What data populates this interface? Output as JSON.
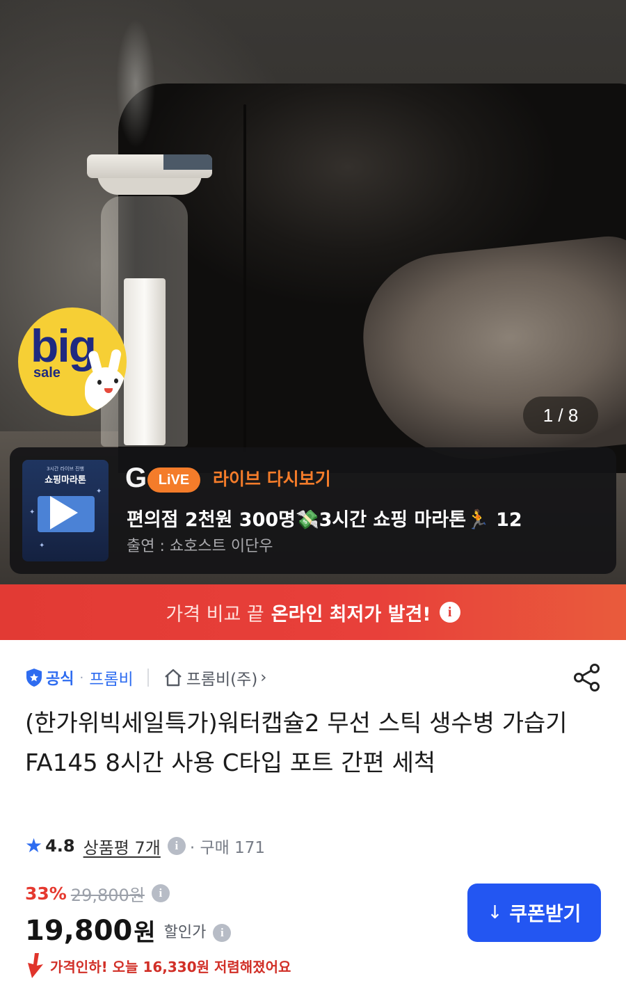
{
  "hero": {
    "badge_big": "big",
    "badge_sale": "sale",
    "pager": "1 / 8"
  },
  "live": {
    "thumb_sub": "3시간 라이브 진행",
    "thumb_title": "쇼핑마라톤",
    "g_logo": "G",
    "live_pill": "LiVE",
    "replay_label": "라이브 다시보기",
    "title": "편의점 2천원 300명💸3시간 쇼핑 마라톤🏃 12",
    "guest": "출연 : 쇼호스트 이단우",
    "accent_color": "#f47c2a"
  },
  "banner": {
    "prefix": "가격 비교 끝",
    "strong": "온라인 최저가 발견!",
    "info_icon": "i",
    "color": "#e23a34"
  },
  "seller": {
    "official": "공식",
    "brand": "프롬비",
    "store": "프롬비(주)",
    "chevron": "›"
  },
  "product": {
    "title": "(한가위빅세일특가)워터캡슐2 무선 스틱 생수병 가습기 FA145 8시간 사용 C타입 포트 간편 세척"
  },
  "rating": {
    "star": "★",
    "value": "4.8",
    "reviews": "상품평 7개",
    "info_icon": "i",
    "purchases": "· 구매 171"
  },
  "price": {
    "discount": "33%",
    "original": "29,800원",
    "sale_amount": "19,800",
    "sale_unit": "원",
    "sale_label": "할인가",
    "info_icon": "i",
    "coupon_button": "쿠폰받기",
    "coupon_icon": "↓",
    "drop_text": "가격인하! 오늘 16,330원 저렴해졌어요",
    "brand_color": "#2356f2",
    "discount_color": "#e5392f"
  }
}
